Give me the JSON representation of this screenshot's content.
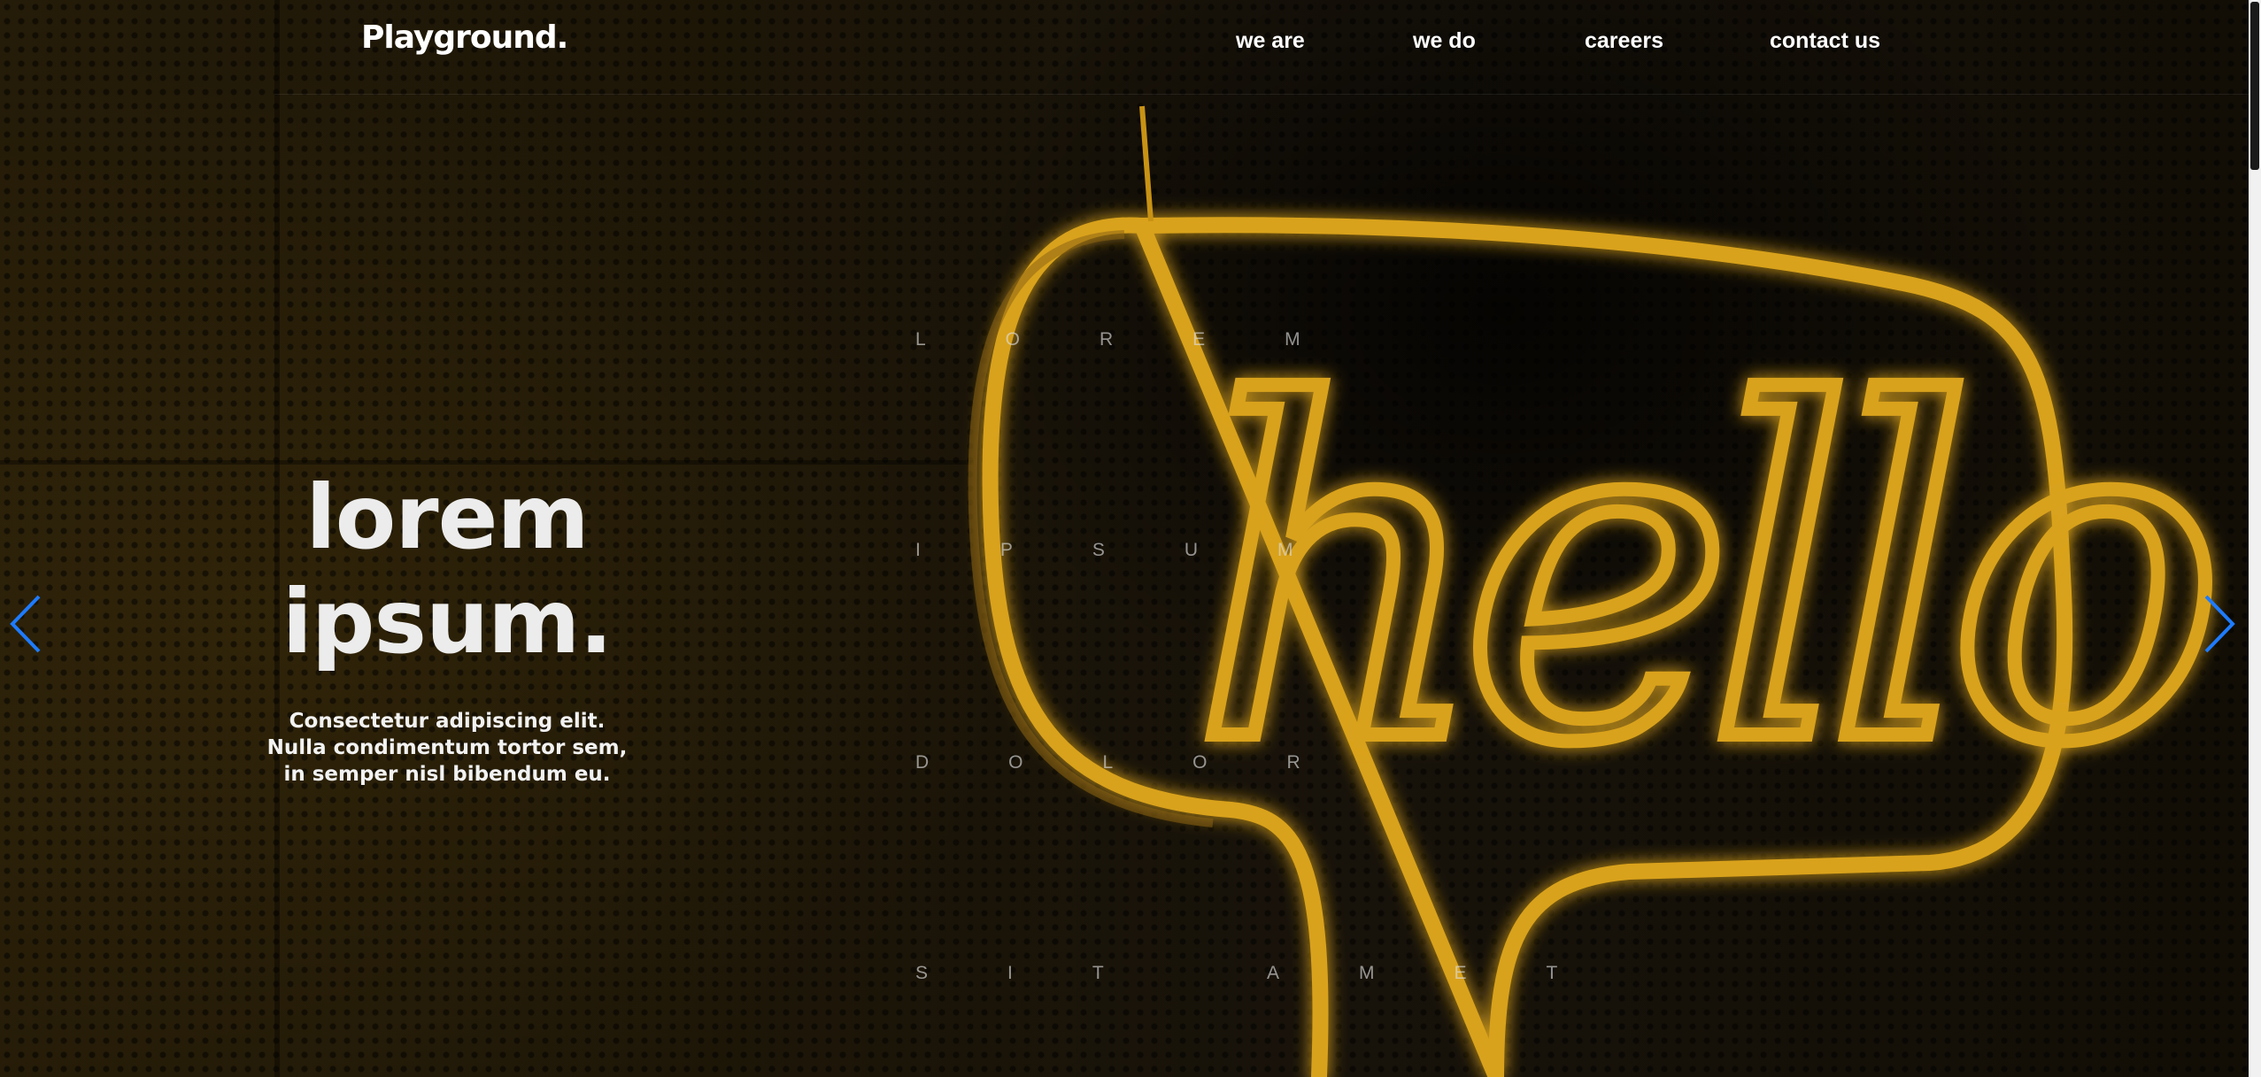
{
  "brand": {
    "logo_text": "Playground."
  },
  "nav": {
    "items": [
      {
        "label": "we are"
      },
      {
        "label": "we do"
      },
      {
        "label": "careers"
      },
      {
        "label": "contact us"
      }
    ]
  },
  "hero": {
    "headline_line1": "lorem",
    "headline_line2": "ipsum.",
    "subtext_line1": "Consectetur adipiscing elit.",
    "subtext_line2": "Nulla condimentum tortor sem,",
    "subtext_line3": "in semper nisl bibendum eu.",
    "spaced_words": [
      "LOREM",
      "IPSUM",
      "DOLOR",
      "SIT AMET"
    ],
    "neon_text": "hello"
  },
  "carousel": {
    "prev_icon": "chevron-left-icon",
    "next_icon": "chevron-right-icon",
    "arrow_color": "#1e7bff"
  },
  "colors": {
    "background": "#1a1408",
    "neon": "#d9a21c",
    "text": "#ffffff"
  }
}
